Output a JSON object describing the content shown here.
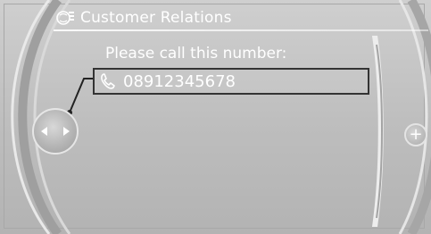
{
  "header": {
    "title": "Customer Relations",
    "icon": "customer-relations-icon"
  },
  "content": {
    "prompt": "Please call this number:",
    "phone_number": "08912345678",
    "phone_icon": "phone-icon"
  },
  "controls": {
    "controller_icon": "controller-joystick-icon",
    "left_arrow_icon": "arrow-left-icon",
    "right_arrow_icon": "arrow-right-icon",
    "plus_label": "+"
  },
  "colors": {
    "background": "#bdbdbd",
    "text": "#ffffff",
    "selection_border": "#333333"
  }
}
